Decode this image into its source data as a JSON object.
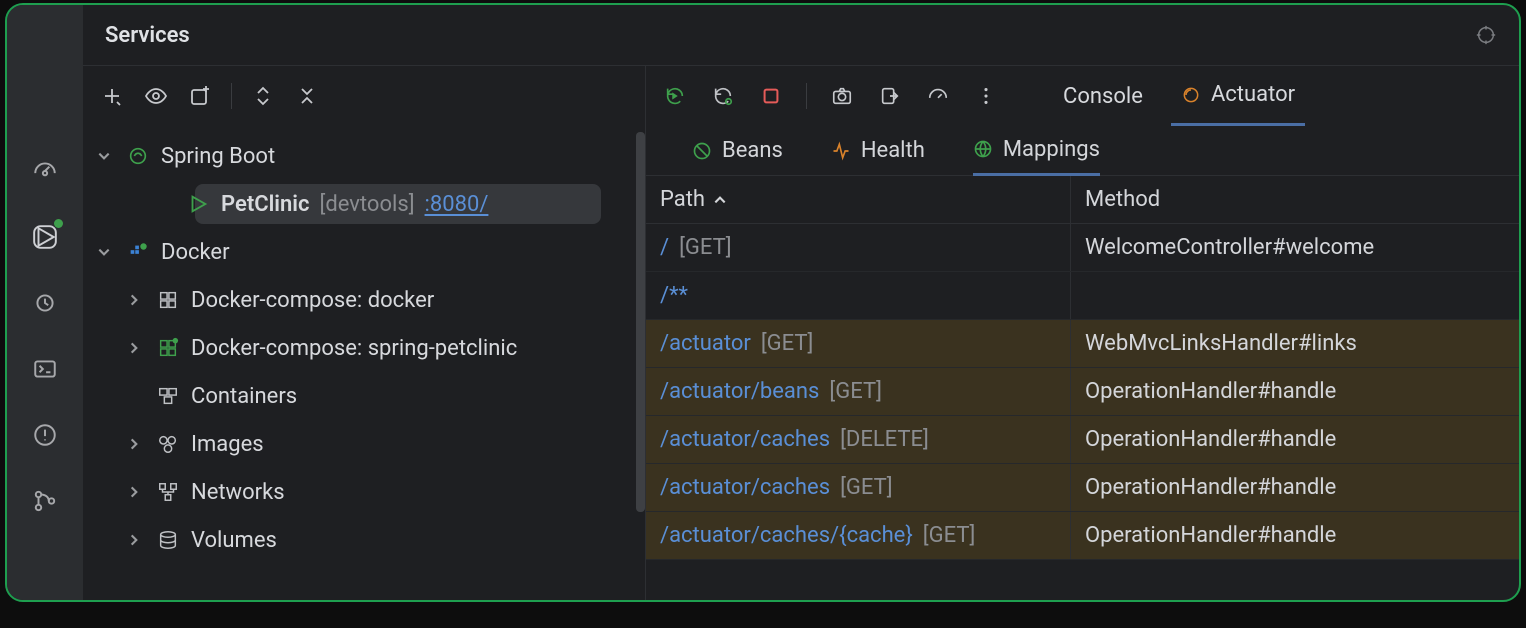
{
  "title": "Services",
  "left_tools": {},
  "tree": {
    "spring_label": "Spring Boot",
    "app": {
      "name": "PetClinic",
      "devtools": "[devtools]",
      "port": ":8080/"
    },
    "docker_label": "Docker",
    "items": {
      "dc_docker": "Docker-compose: docker",
      "dc_spring": "Docker-compose: spring-petclinic",
      "containers": "Containers",
      "images": "Images",
      "networks": "Networks",
      "volumes": "Volumes"
    }
  },
  "top_tabs": {
    "console": "Console",
    "actuator": "Actuator"
  },
  "sub_tabs": {
    "beans": "Beans",
    "health": "Health",
    "mappings": "Mappings"
  },
  "table": {
    "head_path": "Path",
    "head_method": "Method",
    "rows": [
      {
        "path": "/",
        "verb": "[GET]",
        "method": "WelcomeController#welcome",
        "hl": false
      },
      {
        "path": "/**",
        "verb": "",
        "method": "",
        "hl": false
      },
      {
        "path": "/actuator",
        "verb": "[GET]",
        "method": "WebMvcLinksHandler#links",
        "hl": true
      },
      {
        "path": "/actuator/beans",
        "verb": "[GET]",
        "method": "OperationHandler#handle",
        "hl": true
      },
      {
        "path": "/actuator/caches",
        "verb": "[DELETE]",
        "method": "OperationHandler#handle",
        "hl": true
      },
      {
        "path": "/actuator/caches",
        "verb": "[GET]",
        "method": "OperationHandler#handle",
        "hl": true
      },
      {
        "path": "/actuator/caches/{cache}",
        "verb": "[GET]",
        "method": "OperationHandler#handle",
        "hl": true
      }
    ]
  }
}
